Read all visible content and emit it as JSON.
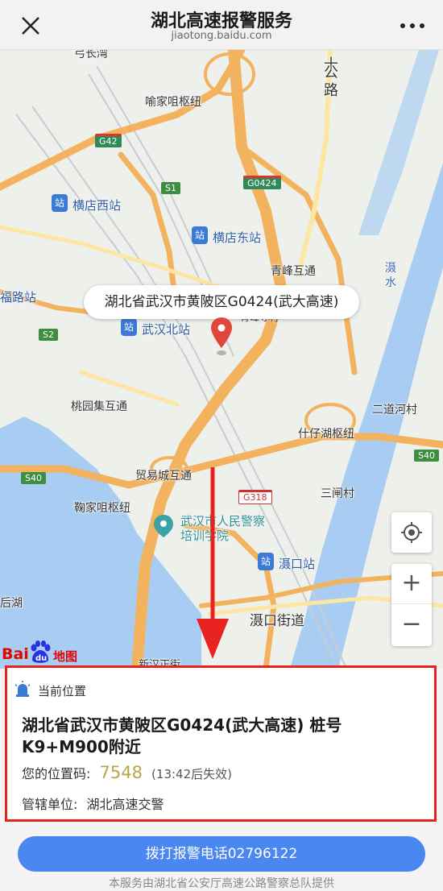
{
  "header": {
    "title": "湖北高速报警服务",
    "subtitle": "jiaotong.baidu.com",
    "close_icon": "close-icon",
    "more_icon": "more-dots-icon"
  },
  "map": {
    "callout": "湖北省武汉市黄陂区G0424(武大高速)",
    "labels": {
      "yujia": "喻家咀枢纽",
      "hengdian_west": "横店西站",
      "hengdian_east": "横店东站",
      "qingfeng": "青峰互通",
      "fulu": "福路站",
      "wuhan_north": "武汉北站",
      "taoyuanji": "桃园集互通",
      "shizaihu": "什仔湖枢纽",
      "maoyicheng": "贸易城互通",
      "jujia": "鞠家咀枢纽",
      "police_school_1": "武汉市人民警察",
      "police_school_2": "培训学院",
      "shekou_station": "滠口站",
      "shekou_street": "滠口街道",
      "erdao": "二道河村",
      "sanzha": "三闸村",
      "shishui": "滠\n水",
      "shigonglu_1": "十",
      "shigonglu_2": "公",
      "shigonglu_3": "路",
      "houhu": "后湖",
      "qingfengsi": "青峰寺村",
      "changwan": "弓长湾",
      "xinhan": "新汉正街"
    },
    "badges": {
      "g42": "G42",
      "s1": "S1",
      "g0424": "G0424",
      "s2": "S2",
      "s40_left": "S40",
      "s40_right": "S40",
      "g318": "G318"
    },
    "controls": {
      "locate_icon": "locate-icon",
      "zoom_in": "+",
      "zoom_out": "−"
    },
    "logo_text_left": "Bai",
    "logo_text_paw": "du",
    "logo_text_right": "地图"
  },
  "info": {
    "heading": "当前位置",
    "address": "湖北省武汉市黄陂区G0424(武大高速) 桩号K9+M900附近",
    "code_label": "您的位置码:",
    "code_value": "7548",
    "code_expiry": "(13:42后失效)",
    "unit_label": "管辖单位:",
    "unit_value": "湖北高速交警"
  },
  "actions": {
    "call_button": "拨打报警电话02796122"
  },
  "footer": {
    "text": "本服务由湖北省公安厅高速公路警察总队提供"
  },
  "colors": {
    "accent": "#4a87f0",
    "highlight_border": "#e8231f",
    "code_value": "#b7a54a",
    "pin": "#e0463a"
  }
}
